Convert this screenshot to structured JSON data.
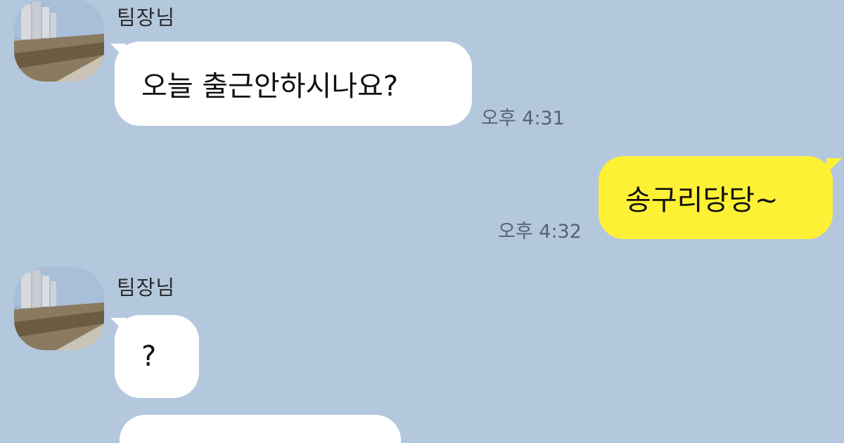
{
  "chat": {
    "messages": [
      {
        "sender": "팀장님",
        "text": "오늘 출근안하시나요?",
        "time": "오후 4:31",
        "direction": "incoming"
      },
      {
        "sender": "me",
        "text": "송구리당당~",
        "time": "오후 4:32",
        "direction": "outgoing"
      },
      {
        "sender": "팀장님",
        "text": "?",
        "time": "",
        "direction": "incoming"
      },
      {
        "sender": "팀장님",
        "text": "",
        "time": "",
        "direction": "incoming"
      }
    ]
  },
  "colors": {
    "background": "#b4c8dd",
    "incoming_bubble": "#ffffff",
    "outgoing_bubble": "#fef135",
    "timestamp": "#566270"
  }
}
